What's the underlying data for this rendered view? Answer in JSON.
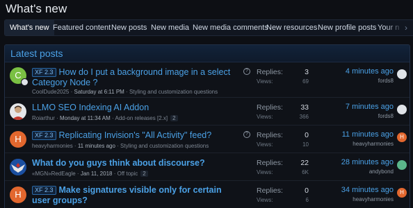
{
  "page_title": "What's new",
  "tabs": [
    {
      "label": "What's new",
      "active": true
    },
    {
      "label": "Featured content"
    },
    {
      "label": "New posts"
    },
    {
      "label": "New media"
    },
    {
      "label": "New media comments"
    },
    {
      "label": "New resources"
    },
    {
      "label": "New profile posts"
    },
    {
      "label": "Your n"
    }
  ],
  "section_title": "Latest posts",
  "colors": {
    "accent": "#4ba1e6",
    "prefix_border": "#2b6aa8",
    "orange_avatar": "#e2672e",
    "green_avatar": "#7ac043"
  },
  "posts": [
    {
      "avatar_letter": "C",
      "avatar_color": "#7ac043",
      "prefix": "XF 2.3",
      "title": "How do I put a background image in a select Category Node ?",
      "author": "CoolDude2025",
      "date": "Saturday at 6:11 PM",
      "forum": "Styling and customization questions",
      "has_question": true,
      "replies_label": "Replies:",
      "replies": "3",
      "views_label": "Views:",
      "views": "69",
      "last_time": "4 minutes ago",
      "last_user": "fords8",
      "last_avatar_color": "#dfe3e8",
      "last_avatar_letter": ""
    },
    {
      "avatar_letter": "",
      "avatar_color": "#e5e7ea",
      "prefix": "",
      "title": "LLMO SEO Indexing AI Addon",
      "author": "Roiarthur",
      "date": "Monday at 11:34 AM",
      "forum": "Add-on releases [2.x]",
      "page_count": "2",
      "has_question": false,
      "replies_label": "Replies:",
      "replies": "33",
      "views_label": "Views:",
      "views": "366",
      "last_time": "7 minutes ago",
      "last_user": "fords8",
      "last_avatar_color": "#dfe3e8",
      "last_avatar_letter": ""
    },
    {
      "avatar_letter": "H",
      "avatar_color": "#e2672e",
      "prefix": "XF 2.3",
      "title": "Replicating Invision's \"All Activity\" feed?",
      "author": "heavyharmonies",
      "date": "11 minutes ago",
      "forum": "Styling and customization questions",
      "has_question": true,
      "replies_label": "Replies:",
      "replies": "0",
      "views_label": "Views:",
      "views": "10",
      "last_time": "11 minutes ago",
      "last_user": "heavyharmonies",
      "last_avatar_color": "#e2672e",
      "last_avatar_letter": "H"
    },
    {
      "avatar_letter": "",
      "avatar_color": "#1b4fa0",
      "prefix": "",
      "title": "What do you guys think about discourse?",
      "author": "«MGN»RedEagle",
      "date": "Jan 11, 2018",
      "forum": "Off topic",
      "page_count": "2",
      "has_question": false,
      "replies_label": "Replies:",
      "replies": "22",
      "views_label": "Views:",
      "views": "6K",
      "last_time": "28 minutes ago",
      "last_user": "andybond",
      "last_avatar_color": "#5ab58a",
      "last_avatar_letter": ""
    },
    {
      "avatar_letter": "H",
      "avatar_color": "#e2672e",
      "prefix": "XF 2.3",
      "title": "Make signatures visible only for certain user groups?",
      "author": "heavyharmonies",
      "date": "",
      "forum": "",
      "has_question": false,
      "replies_label": "Replies:",
      "replies": "0",
      "views_label": "Views:",
      "views": "6",
      "last_time": "34 minutes ago",
      "last_user": "heavyharmonies",
      "last_avatar_color": "#e2672e",
      "last_avatar_letter": "H"
    }
  ]
}
